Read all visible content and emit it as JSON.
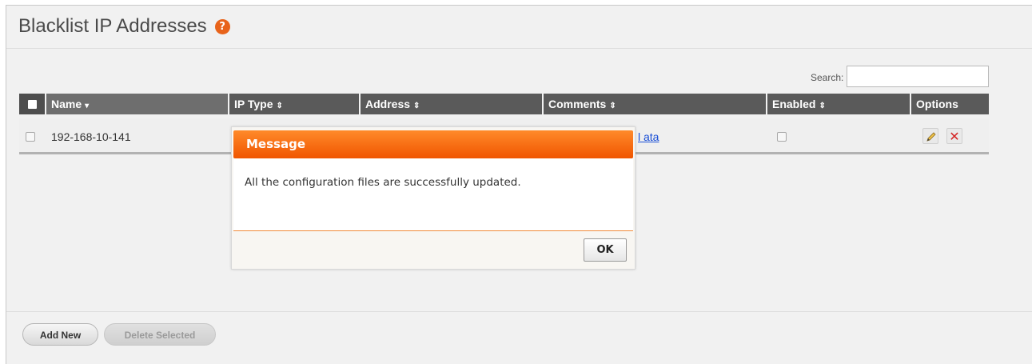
{
  "page": {
    "title": "Blacklist IP Addresses",
    "help_glyph": "?"
  },
  "search": {
    "label": "Search:",
    "value": ""
  },
  "table": {
    "columns": [
      {
        "label": "Name",
        "sort": "▾"
      },
      {
        "label": "IP Type",
        "sort": "⇕"
      },
      {
        "label": "Address",
        "sort": "⇕"
      },
      {
        "label": "Comments",
        "sort": "⇕"
      },
      {
        "label": "Enabled",
        "sort": "⇕"
      },
      {
        "label": "Options",
        "sort": ""
      }
    ],
    "rows": [
      {
        "name": "192-168-10-141",
        "comments_link": "l ata",
        "enabled": false,
        "selected": false
      }
    ]
  },
  "buttons": {
    "add_new": "Add New",
    "delete_selected": "Delete Selected"
  },
  "dialog": {
    "title": "Message",
    "message": "All the configuration files are successfully updated.",
    "ok_label": "OK"
  },
  "colors": {
    "accent": "#f05500",
    "help_icon": "#e8631a",
    "header_bg": "#5a5a5a",
    "link": "#1a4fd6",
    "delete": "#d42525"
  },
  "icons": {
    "help": "help-icon",
    "edit": "pencil-icon",
    "delete": "close-icon"
  }
}
